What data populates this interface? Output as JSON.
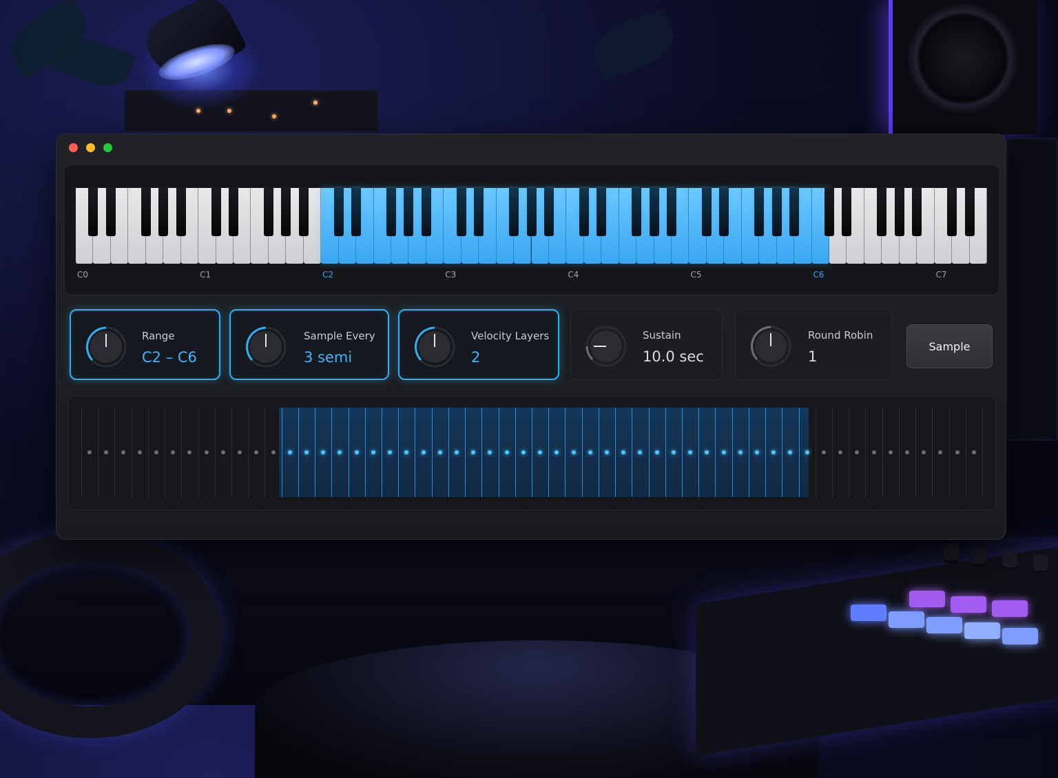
{
  "window": {
    "traffic_lights": [
      "close",
      "minimize",
      "maximize"
    ],
    "traffic_colors": [
      "#ff5f57",
      "#febc2e",
      "#28c840"
    ]
  },
  "keyboard": {
    "octave_labels": [
      "C0",
      "C1",
      "C2",
      "C3",
      "C4",
      "C5",
      "C6",
      "C7"
    ],
    "highlighted_labels": [
      "C2",
      "C6"
    ],
    "selected_range": "C2 – C6",
    "accent_color": "#3aa7f2"
  },
  "controls": {
    "range": {
      "label": "Range",
      "value": "C2 – C6",
      "active": true
    },
    "sample_every": {
      "label": "Sample Every",
      "value": "3 semi",
      "active": true
    },
    "velocity_layers": {
      "label": "Velocity Layers",
      "value": "2",
      "active": true
    },
    "sustain": {
      "label": "Sustain",
      "value": "10.0 sec",
      "active": false
    },
    "round_robin": {
      "label": "Round Robin",
      "value": "1",
      "active": false
    }
  },
  "actions": {
    "sample_button": "Sample"
  },
  "zones": {
    "description_color": "#4fc4ff"
  }
}
